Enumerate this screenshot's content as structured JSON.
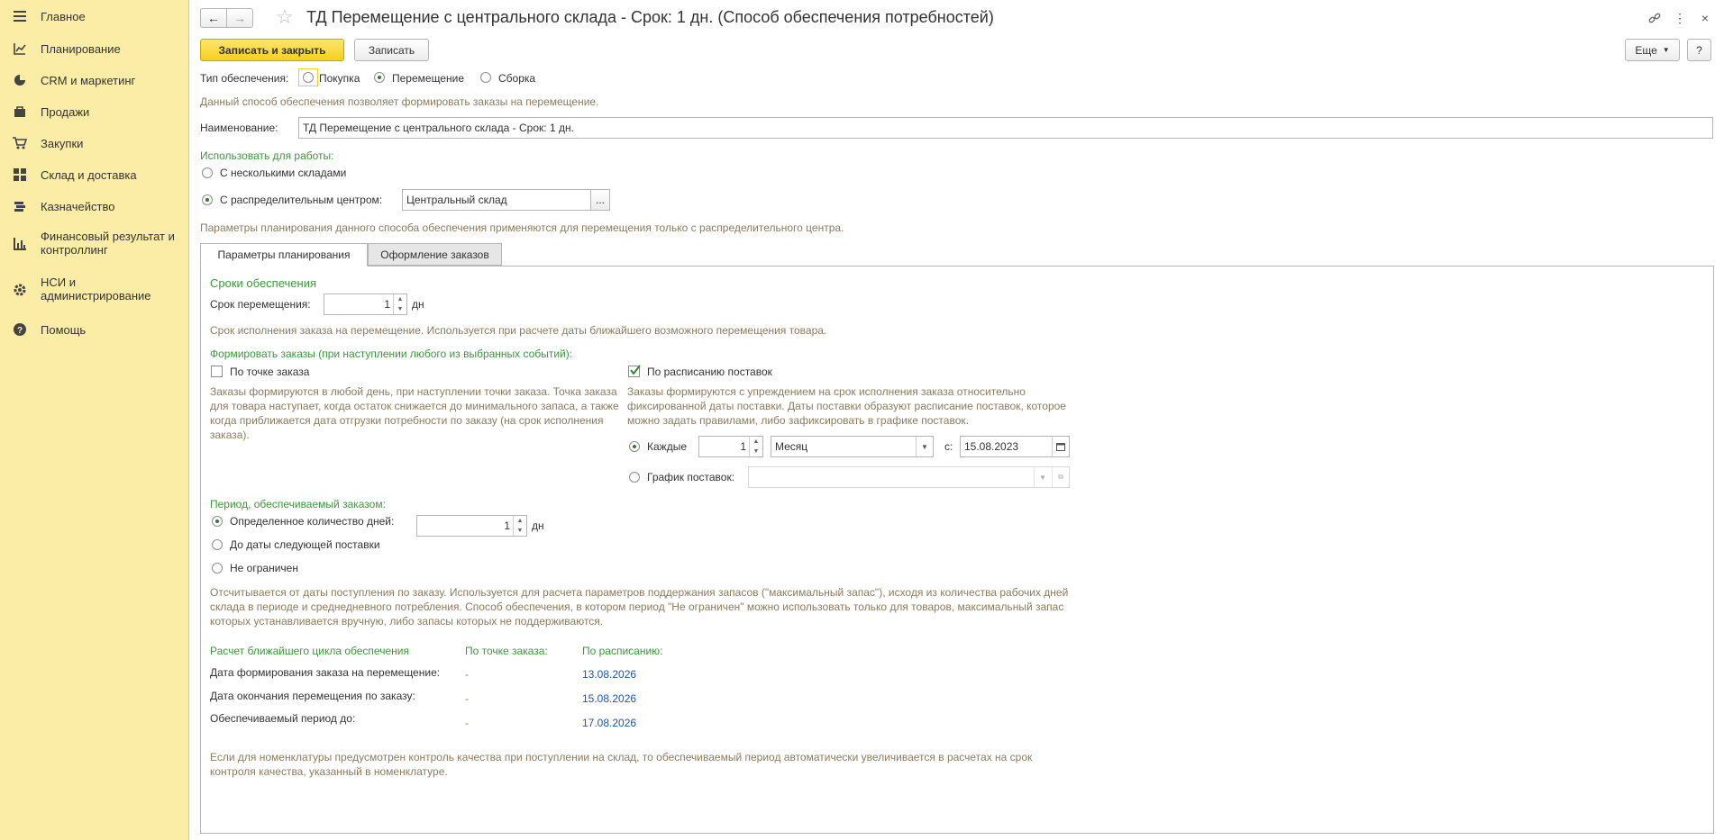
{
  "sidebar": {
    "items": [
      {
        "label": "Главное",
        "icon": "menu-icon"
      },
      {
        "label": "Планирование",
        "icon": "chart-line-icon"
      },
      {
        "label": "CRM и маркетинг",
        "icon": "pie-chart-icon"
      },
      {
        "label": "Продажи",
        "icon": "bag-icon"
      },
      {
        "label": "Закупки",
        "icon": "cart-icon"
      },
      {
        "label": "Склад и доставка",
        "icon": "warehouse-icon"
      },
      {
        "label": "Казначейство",
        "icon": "treasury-icon"
      },
      {
        "label": "Финансовый результат и контроллинг",
        "icon": "bar-chart-icon"
      },
      {
        "label": "НСИ и администрирование",
        "icon": "gear-icon"
      },
      {
        "label": "Помощь",
        "icon": "help-icon"
      }
    ]
  },
  "header": {
    "title": "ТД Перемещение с центрального склада - Срок: 1 дн. (Способ обеспечения потребностей)"
  },
  "toolbar": {
    "save_close": "Записать и закрыть",
    "save": "Записать",
    "more": "Еще",
    "help": "?"
  },
  "form": {
    "supply_type_label": "Тип обеспечения:",
    "supply_types": [
      "Покупка",
      "Перемещение",
      "Сборка"
    ],
    "supply_type_selected": "Перемещение",
    "supply_hint": "Данный способ обеспечения позволяет формировать заказы на перемещение.",
    "name_label": "Наименование:",
    "name_value": "ТД Перемещение с центрального склада - Срок: 1 дн.",
    "use_for_work": "Использовать для работы:",
    "multi_warehouses": "С несколькими складами",
    "dist_center_label": "С распределительным центром:",
    "dist_center_value": "Центральный склад",
    "dist_center_btn": "...",
    "dist_hint": "Параметры планирования данного способа обеспечения применяются для перемещения только с распределительного центра."
  },
  "tabs": [
    {
      "label": "Параметры планирования",
      "active": true
    },
    {
      "label": "Оформление заказов",
      "active": false
    }
  ],
  "planning": {
    "terms_title": "Сроки обеспечения",
    "move_term_label": "Срок перемещения:",
    "move_term_value": "1",
    "move_term_unit": "дн",
    "move_term_hint": "Срок исполнения заказа на перемещение. Используется при расчете даты ближайшего возможного перемещения товара.",
    "form_orders_title": "Формировать заказы (при наступлении любого из выбранных событий):",
    "order_point_label": "По точке заказа",
    "order_point_checked": false,
    "order_point_hint": "Заказы формируются в любой день, при наступлении точки заказа. Точка заказа для товара наступает, когда остаток снижается до минимального запаса, а также когда приближается дата отгрузки потребности по заказу (на срок исполнения заказа).",
    "schedule_label": "По расписанию поставок",
    "schedule_checked": true,
    "schedule_hint": "Заказы формируются с упреждением на срок исполнения заказа относительно фиксированной даты поставки. Даты поставки образуют расписание поставок, которое можно задать правилами, либо зафиксировать в графике поставок.",
    "every_label": "Каждые",
    "every_value": "1",
    "period_value": "Месяц",
    "from_label": "с:",
    "from_value": "15.08.2023",
    "delivery_schedule_label": "График поставок:",
    "delivery_schedule_value": "",
    "period_title": "Период, обеспечиваемый заказом:",
    "period_days_label": "Определенное количество дней:",
    "period_days_value": "1",
    "period_days_unit": "дн",
    "period_next_label": "До даты следующей поставки",
    "period_unlimited_label": "Не ограничен",
    "period_hint": "Отсчитывается от даты поступления по заказу. Используется для расчета параметров поддержания запасов (\"максимальный запас\"), исходя из количества рабочих дней склада в периоде и среднедневного потребления. Способ обеспечения, в котором период \"Не ограничен\" можно использовать только для товаров, максимальный запас которых устанавливается вручную, либо запасы которых не поддерживаются.",
    "calc_title": "Расчет ближайшего цикла обеспечения",
    "col_order_point": "По точке заказа:",
    "col_schedule": "По расписанию:",
    "rows": [
      {
        "label": "Дата формирования заказа на перемещение:",
        "order_point": "-",
        "schedule": "13.08.2026"
      },
      {
        "label": "Дата окончания перемещения по заказу:",
        "order_point": "-",
        "schedule": "15.08.2026"
      },
      {
        "label": "Обеспечиваемый период до:",
        "order_point": "-",
        "schedule": "17.08.2026"
      }
    ],
    "quality_hint": "Если для номенклатуры предусмотрен контроль качества при поступлении на склад, то обеспечиваемый период автоматически увеличивается в расчетах на срок контроля качества, указанный в номенклатуре."
  },
  "colors": {
    "sidebar_bg": "#fbeda6",
    "accent_yellow": "#f5cf1f",
    "green": "#3a9a3a",
    "hint": "#8d7b5d",
    "link_blue": "#1f57a8"
  }
}
